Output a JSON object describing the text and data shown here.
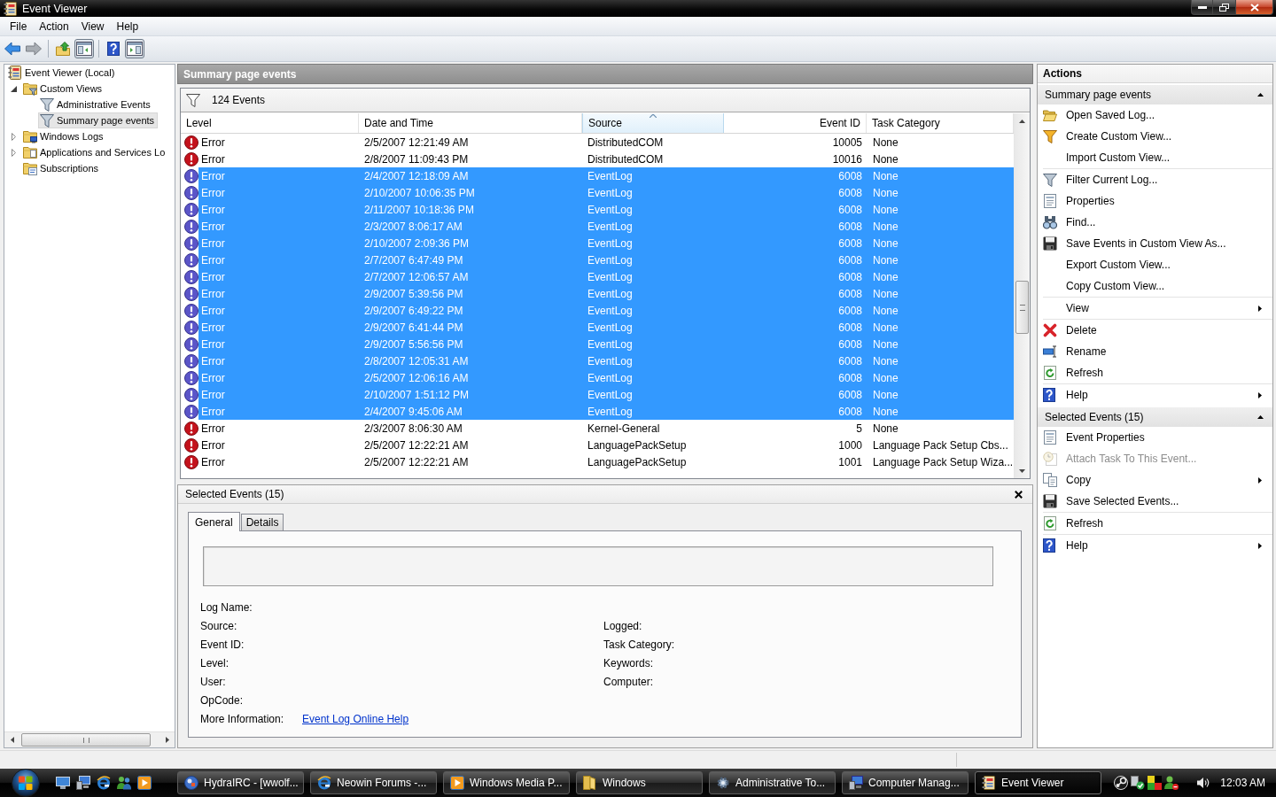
{
  "window": {
    "title": "Event Viewer"
  },
  "menu": [
    {
      "label": "File"
    },
    {
      "label": "Action"
    },
    {
      "label": "View"
    },
    {
      "label": "Help"
    }
  ],
  "toolbar": {
    "groups": [
      {
        "buttons": [
          {
            "kind": "back",
            "pressed": false,
            "disabled": false
          },
          {
            "kind": "forward",
            "pressed": false,
            "disabled": true
          }
        ]
      },
      {
        "buttons": [
          {
            "kind": "up",
            "pressed": false,
            "disabled": false
          },
          {
            "kind": "tree-toggle",
            "pressed": true,
            "disabled": false
          }
        ]
      },
      {
        "buttons": [
          {
            "kind": "help",
            "pressed": false,
            "disabled": false
          },
          {
            "kind": "actions-toggle",
            "pressed": true,
            "disabled": false
          }
        ]
      }
    ]
  },
  "tree": {
    "items": [
      {
        "label": "Event Viewer (Local)",
        "kind": "root",
        "selected": false,
        "children": [
          {
            "label": "Custom Views",
            "kind": "views-folder",
            "selected": false,
            "expanded": true,
            "children": [
              {
                "label": "Administrative Events",
                "kind": "view",
                "selected": false
              },
              {
                "label": "Summary page events",
                "kind": "view",
                "selected": true
              }
            ]
          },
          {
            "label": "Windows Logs",
            "kind": "logs-folder",
            "selected": false,
            "expanded": false
          },
          {
            "label": "Applications and Services Lo",
            "kind": "folder",
            "selected": false,
            "expanded": false
          },
          {
            "label": "Subscriptions",
            "kind": "subscriptions",
            "selected": false
          }
        ]
      }
    ]
  },
  "content": {
    "title": "Summary page events",
    "event_count": "124 Events",
    "table": {
      "columns": [
        {
          "label": "Level",
          "sorted": false
        },
        {
          "label": "Date and Time",
          "sorted": false
        },
        {
          "label": "Source",
          "sorted": true
        },
        {
          "label": "Event ID",
          "sorted": false
        },
        {
          "label": "Task Category",
          "sorted": false
        }
      ],
      "rows": [
        {
          "level": "Error",
          "date_and_time": "2/5/2007 12:21:49 AM",
          "source": "DistributedCOM",
          "event_id": "10005",
          "task_category": "None",
          "selected": false
        },
        {
          "level": "Error",
          "date_and_time": "2/8/2007 11:09:43 PM",
          "source": "DistributedCOM",
          "event_id": "10016",
          "task_category": "None",
          "selected": false
        },
        {
          "level": "Error",
          "date_and_time": "2/4/2007 12:18:09 AM",
          "source": "EventLog",
          "event_id": "6008",
          "task_category": "None",
          "selected": true
        },
        {
          "level": "Error",
          "date_and_time": "2/10/2007 10:06:35 PM",
          "source": "EventLog",
          "event_id": "6008",
          "task_category": "None",
          "selected": true
        },
        {
          "level": "Error",
          "date_and_time": "2/11/2007 10:18:36 PM",
          "source": "EventLog",
          "event_id": "6008",
          "task_category": "None",
          "selected": true
        },
        {
          "level": "Error",
          "date_and_time": "2/3/2007 8:06:17 AM",
          "source": "EventLog",
          "event_id": "6008",
          "task_category": "None",
          "selected": true
        },
        {
          "level": "Error",
          "date_and_time": "2/10/2007 2:09:36 PM",
          "source": "EventLog",
          "event_id": "6008",
          "task_category": "None",
          "selected": true
        },
        {
          "level": "Error",
          "date_and_time": "2/7/2007 6:47:49 PM",
          "source": "EventLog",
          "event_id": "6008",
          "task_category": "None",
          "selected": true
        },
        {
          "level": "Error",
          "date_and_time": "2/7/2007 12:06:57 AM",
          "source": "EventLog",
          "event_id": "6008",
          "task_category": "None",
          "selected": true
        },
        {
          "level": "Error",
          "date_and_time": "2/9/2007 5:39:56 PM",
          "source": "EventLog",
          "event_id": "6008",
          "task_category": "None",
          "selected": true
        },
        {
          "level": "Error",
          "date_and_time": "2/9/2007 6:49:22 PM",
          "source": "EventLog",
          "event_id": "6008",
          "task_category": "None",
          "selected": true
        },
        {
          "level": "Error",
          "date_and_time": "2/9/2007 6:41:44 PM",
          "source": "EventLog",
          "event_id": "6008",
          "task_category": "None",
          "selected": true
        },
        {
          "level": "Error",
          "date_and_time": "2/9/2007 5:56:56 PM",
          "source": "EventLog",
          "event_id": "6008",
          "task_category": "None",
          "selected": true
        },
        {
          "level": "Error",
          "date_and_time": "2/8/2007 12:05:31 AM",
          "source": "EventLog",
          "event_id": "6008",
          "task_category": "None",
          "selected": true
        },
        {
          "level": "Error",
          "date_and_time": "2/5/2007 12:06:16 AM",
          "source": "EventLog",
          "event_id": "6008",
          "task_category": "None",
          "selected": true
        },
        {
          "level": "Error",
          "date_and_time": "2/10/2007 1:51:12 PM",
          "source": "EventLog",
          "event_id": "6008",
          "task_category": "None",
          "selected": true
        },
        {
          "level": "Error",
          "date_and_time": "2/4/2007 9:45:06 AM",
          "source": "EventLog",
          "event_id": "6008",
          "task_category": "None",
          "selected": true
        },
        {
          "level": "Error",
          "date_and_time": "2/3/2007 8:06:30 AM",
          "source": "Kernel-General",
          "event_id": "5",
          "task_category": "None",
          "selected": false
        },
        {
          "level": "Error",
          "date_and_time": "2/5/2007 12:22:21 AM",
          "source": "LanguagePackSetup",
          "event_id": "1000",
          "task_category": "Language Pack Setup Cbs...",
          "selected": false
        },
        {
          "level": "Error",
          "date_and_time": "2/5/2007 12:22:21 AM",
          "source": "LanguagePackSetup",
          "event_id": "1001",
          "task_category": "Language Pack Setup Wiza...",
          "selected": false
        }
      ]
    }
  },
  "details": {
    "title": "Selected Events (15)",
    "tabs": [
      {
        "label": "General",
        "selected": true
      },
      {
        "label": "Details",
        "selected": false
      }
    ],
    "fields": [
      {
        "left": "Log Name:"
      },
      {
        "left": "Source:",
        "right": "Logged:"
      },
      {
        "left": "Event ID:",
        "right": "Task Category:"
      },
      {
        "left": "Level:",
        "right": "Keywords:"
      },
      {
        "left": "User:",
        "right": "Computer:"
      },
      {
        "left": "OpCode:"
      }
    ],
    "more_information": {
      "label": "More Information:",
      "link": "Event Log Online Help"
    }
  },
  "actions": {
    "title": "Actions",
    "sections": [
      {
        "title": "Summary page events",
        "expanded": true,
        "groups": [
          {
            "items": [
              {
                "label": "Open Saved Log...",
                "kind": "open",
                "disabled": false,
                "submenu": false
              },
              {
                "label": "Create Custom View...",
                "kind": "create-view",
                "disabled": false,
                "submenu": false
              },
              {
                "label": "Import Custom View...",
                "kind": "plain",
                "disabled": false,
                "submenu": false
              }
            ]
          },
          {
            "items": [
              {
                "label": "Filter Current Log...",
                "kind": "filter",
                "disabled": false,
                "submenu": false
              },
              {
                "label": "Properties",
                "kind": "properties",
                "disabled": false,
                "submenu": false
              },
              {
                "label": "Find...",
                "kind": "find",
                "disabled": false,
                "submenu": false
              },
              {
                "label": "Save Events in Custom View As...",
                "kind": "save",
                "disabled": false,
                "submenu": false
              },
              {
                "label": "Export Custom View...",
                "kind": "plain",
                "disabled": false,
                "submenu": false
              },
              {
                "label": "Copy Custom View...",
                "kind": "plain",
                "disabled": false,
                "submenu": false
              }
            ]
          },
          {
            "items": [
              {
                "label": "View",
                "kind": "plain",
                "disabled": false,
                "submenu": true
              }
            ]
          },
          {
            "items": [
              {
                "label": "Delete",
                "kind": "delete",
                "disabled": false,
                "submenu": false
              },
              {
                "label": "Rename",
                "kind": "rename",
                "disabled": false,
                "submenu": false
              },
              {
                "label": "Refresh",
                "kind": "refresh",
                "disabled": false,
                "submenu": false
              }
            ]
          },
          {
            "items": [
              {
                "label": "Help",
                "kind": "help",
                "disabled": false,
                "submenu": true
              }
            ]
          }
        ]
      },
      {
        "title": "Selected Events (15)",
        "expanded": true,
        "groups": [
          {
            "items": [
              {
                "label": "Event Properties",
                "kind": "properties",
                "disabled": false,
                "submenu": false
              },
              {
                "label": "Attach Task To This Event...",
                "kind": "attach",
                "disabled": true,
                "submenu": false
              },
              {
                "label": "Copy",
                "kind": "copy",
                "disabled": false,
                "submenu": true
              },
              {
                "label": "Save Selected Events...",
                "kind": "save",
                "disabled": false,
                "submenu": false
              }
            ]
          },
          {
            "items": [
              {
                "label": "Refresh",
                "kind": "refresh",
                "disabled": false,
                "submenu": false
              }
            ]
          },
          {
            "items": [
              {
                "label": "Help",
                "kind": "help",
                "disabled": false,
                "submenu": true
              }
            ]
          }
        ]
      }
    ]
  },
  "taskbar": {
    "tasks": [
      {
        "label": "HydraIRC - [wwolf...",
        "kind": "ball",
        "selected": false
      },
      {
        "label": "Neowin Forums -...",
        "kind": "browser",
        "selected": false
      },
      {
        "label": "Windows Media P...",
        "kind": "player",
        "selected": false
      },
      {
        "label": "Windows",
        "kind": "folder",
        "selected": false
      },
      {
        "label": "Administrative To...",
        "kind": "tools",
        "selected": false
      },
      {
        "label": "Computer Manag...",
        "kind": "computer",
        "selected": false
      },
      {
        "label": "Event Viewer",
        "kind": "notebook",
        "selected": true
      }
    ],
    "clock": "12:03 AM"
  }
}
